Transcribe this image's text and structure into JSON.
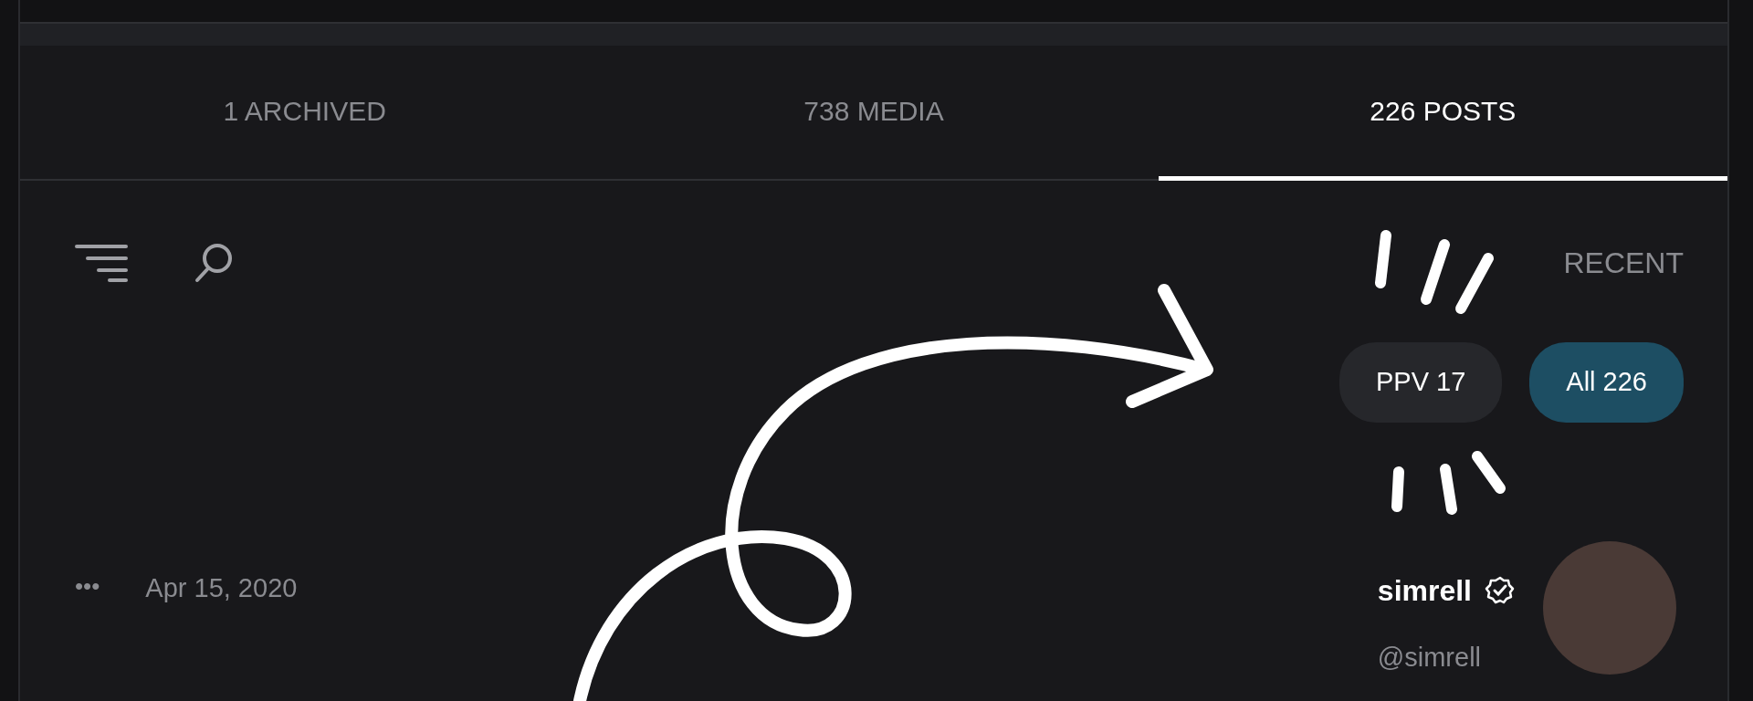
{
  "tabs": [
    {
      "label": "1 ARCHIVED",
      "selected": false
    },
    {
      "label": "738 MEDIA",
      "selected": false
    },
    {
      "label": "226 POSTS",
      "selected": true
    }
  ],
  "section_label": "RECENT",
  "filters": [
    {
      "label": "PPV 17",
      "selected": false
    },
    {
      "label": "All 226",
      "selected": true
    }
  ],
  "post": {
    "name": "simrell",
    "verified": true,
    "handle": "@simrell",
    "date": "Apr 15, 2020",
    "more": "•••"
  }
}
